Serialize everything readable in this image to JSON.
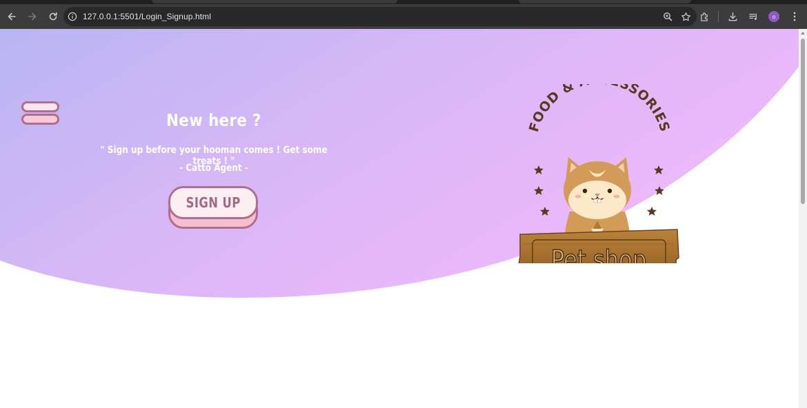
{
  "browser": {
    "url": "127.0.0.1:5501/Login_Signup.html",
    "avatar_initial": "o"
  },
  "page": {
    "panel": {
      "title": "New here ?",
      "quote": "\" Sign up before your hooman comes !   Get some treats ! \"",
      "author": "- Catto Agent -",
      "signup_label": "SIGN UP"
    },
    "logo": {
      "arc_text": "FOOD & ACCESSORIES",
      "sign_text": "Pet shop"
    }
  },
  "colors": {
    "gradient_start": "#b9b6f3",
    "gradient_end": "#f0b8fb",
    "button_border": "#b06e8e",
    "button_face": "#fdeef2",
    "button_shadow": "#f6bfd0",
    "button_text": "#a26884",
    "logo_brown": "#5a3a1e",
    "sign_wood": "#a8742f"
  },
  "icons": {
    "back": "arrow-left-icon",
    "forward": "arrow-right-icon",
    "reload": "reload-icon",
    "site_info": "info-icon",
    "zoom": "zoom-icon",
    "bookmark": "star-icon",
    "extensions": "puzzle-icon",
    "downloads": "download-icon",
    "media": "media-icon",
    "menu": "kebab-menu-icon"
  }
}
